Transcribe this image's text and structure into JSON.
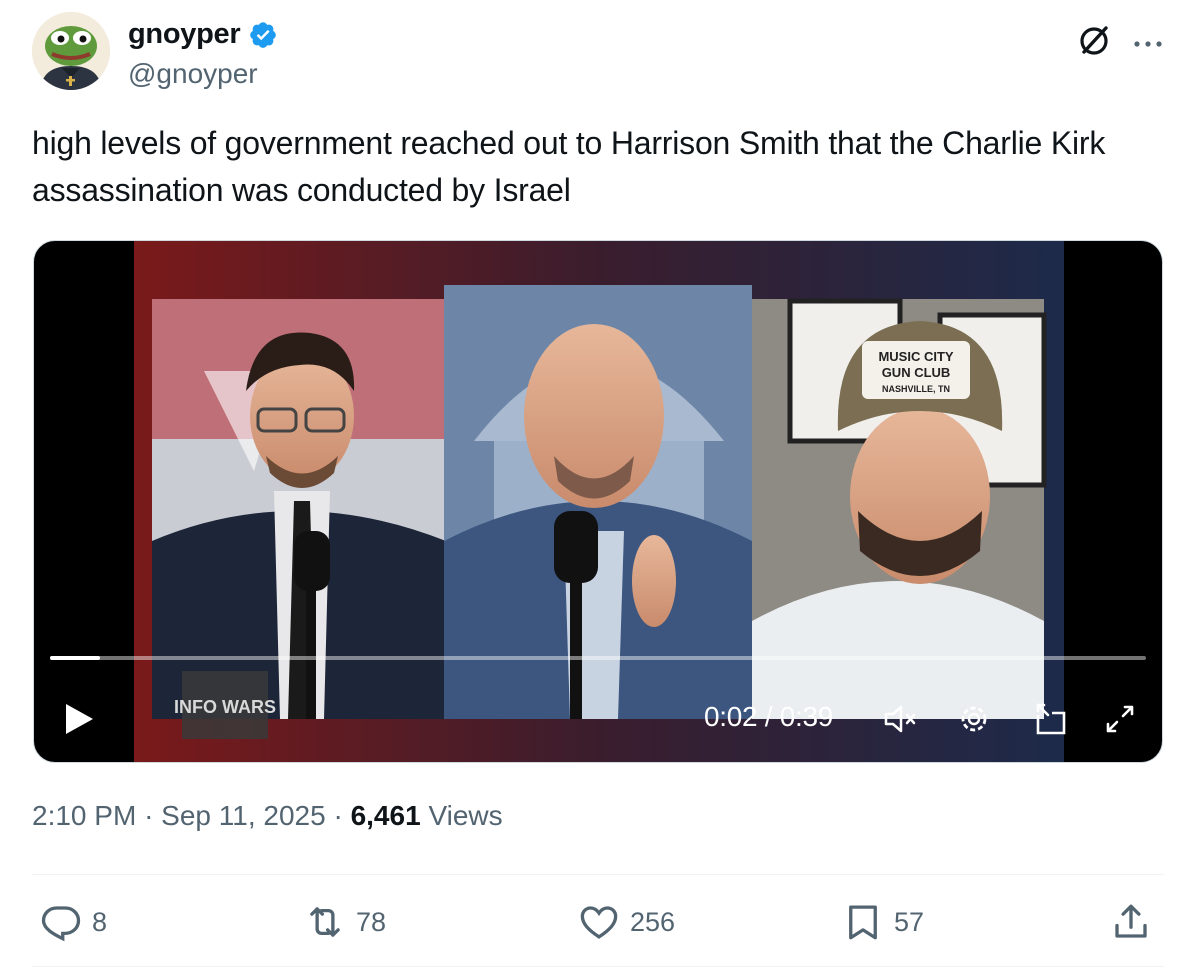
{
  "author": {
    "display_name": "gnoyper",
    "handle": "@gnoyper",
    "verified": true
  },
  "tweet": {
    "text": "high levels of government reached out to Harrison Smith that the Charlie Kirk assassination was conducted by Israel"
  },
  "video": {
    "time": "0:02 / 0:39",
    "progress": 0.046,
    "overlay_text": {
      "logo": "INFO WARS",
      "cap_line1": "MUSIC CITY",
      "cap_line2": "GUN CLUB",
      "cap_line3": "NASHVILLE, TN"
    }
  },
  "meta": {
    "time": "2:10 PM",
    "date": "Sep 11, 2025",
    "views_count": "6,461",
    "views_label": "Views"
  },
  "actions": {
    "replies": "8",
    "reposts": "78",
    "likes": "256",
    "bookmarks": "57"
  },
  "colors": {
    "verified_blue": "#1d9bf0",
    "secondary_text": "#536471",
    "primary_text": "#0f1419"
  }
}
